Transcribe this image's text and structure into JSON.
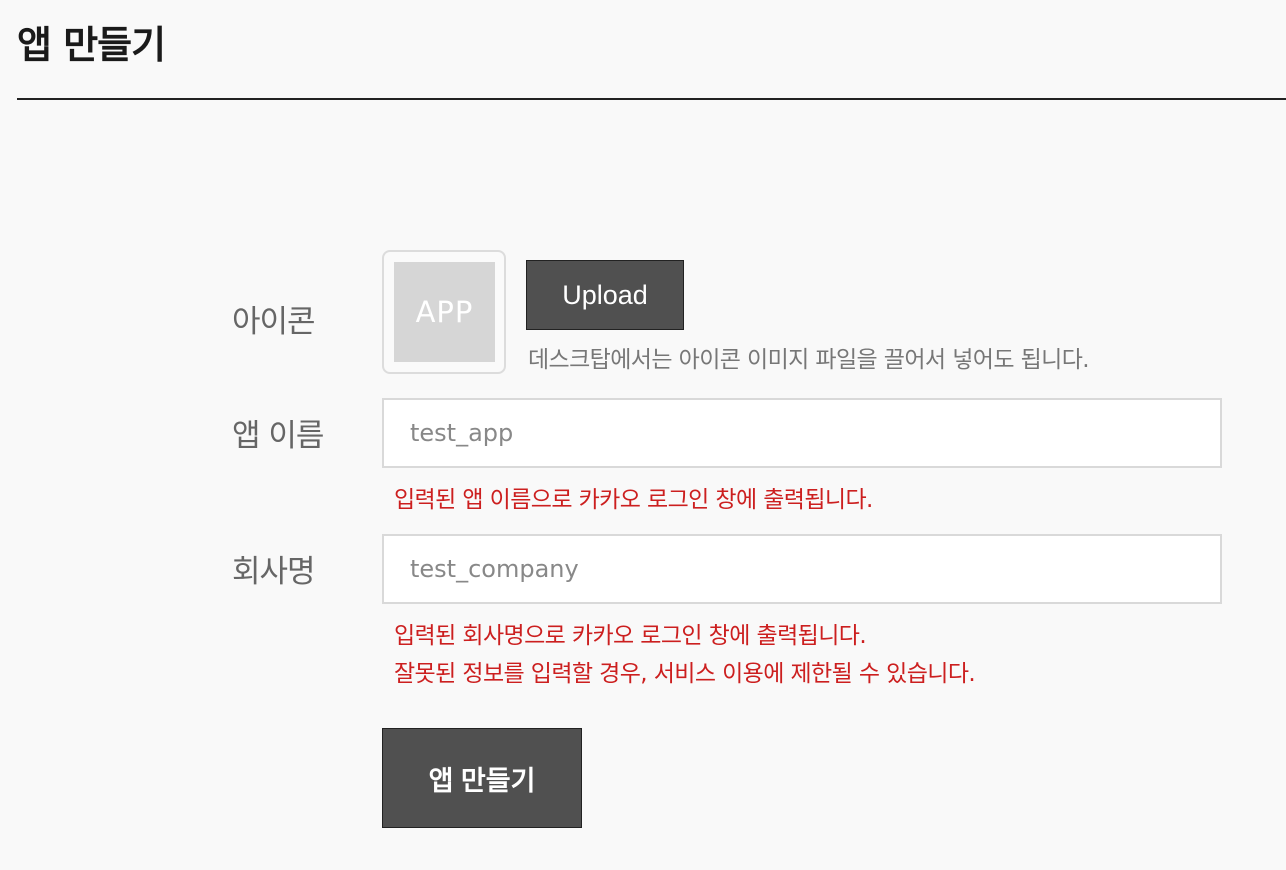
{
  "page": {
    "title": "앱 만들기"
  },
  "form": {
    "icon": {
      "label": "아이콘",
      "placeholder_text": "APP",
      "upload_label": "Upload",
      "hint": "데스크탑에서는 아이콘 이미지 파일을 끌어서 넣어도 됩니다."
    },
    "app_name": {
      "label": "앱 이름",
      "placeholder": "test_app",
      "value": "",
      "hint": "입력된 앱 이름으로 카카오 로그인 창에 출력됩니다."
    },
    "company": {
      "label": "회사명",
      "placeholder": "test_company",
      "value": "",
      "hint_1": "입력된 회사명으로 카카오 로그인 창에 출력됩니다.",
      "hint_2": "잘못된 정보를 입력할 경우, 서비스 이용에 제한될 수 있습니다."
    },
    "submit_label": "앱 만들기"
  },
  "colors": {
    "background": "#f9f9f9",
    "button": "#505050",
    "warning_text": "#cc1f1f",
    "label_text": "#666666"
  }
}
